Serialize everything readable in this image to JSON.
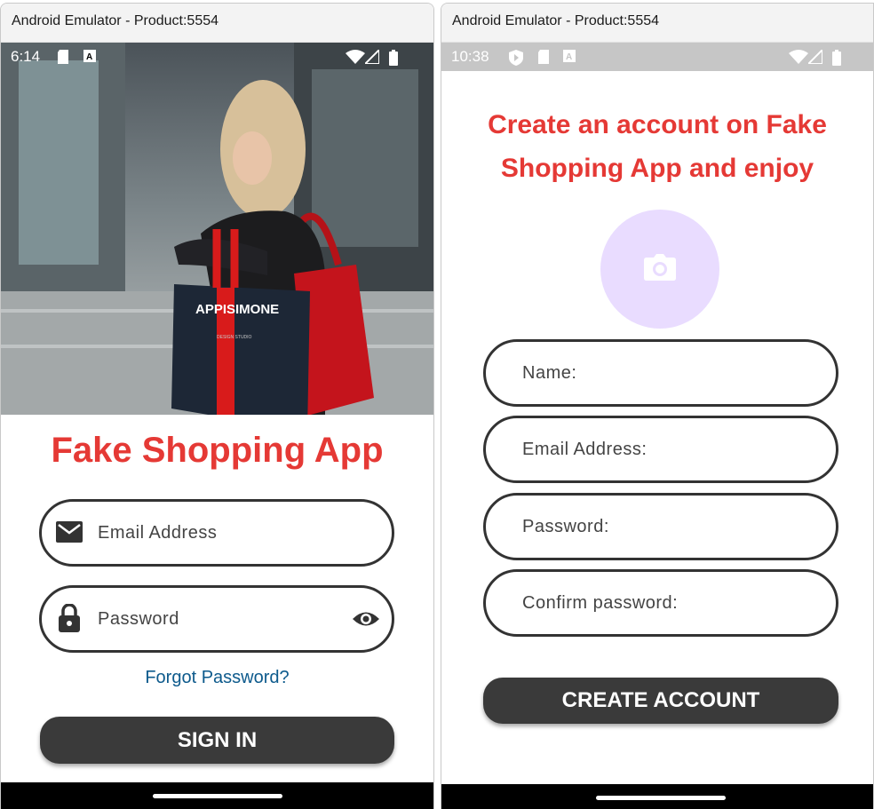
{
  "windows": {
    "left": {
      "title": "Android Emulator - Product:5554",
      "status_time": "6:14",
      "hero": {
        "bag_text": "APPISIMONE",
        "bag_subtext": "DESIGN STUDIO"
      },
      "app_title": "Fake Shopping App",
      "email_label": "Email Address",
      "password_label": "Password",
      "forgot_password": "Forgot Password?",
      "sign_in": "SIGN IN"
    },
    "right": {
      "title": "Android Emulator - Product:5554",
      "status_time": "10:38",
      "heading_line1": "Create an account on Fake",
      "heading_line2": "Shopping App and enjoy",
      "name_label": "Name:",
      "email_label": "Email Address:",
      "password_label": "Password:",
      "confirm_label": "Confirm password:",
      "create_account": "CREATE ACCOUNT"
    }
  },
  "colors": {
    "accent_red": "#e53935",
    "link_blue": "#0d5a8c",
    "button_dark": "#3a3a3a",
    "avatar_bg": "#e9dcff"
  },
  "icons": [
    "email-icon",
    "lock-icon",
    "eye-icon",
    "camera-icon",
    "wifi-icon",
    "signal-icon",
    "battery-icon",
    "sd-card-icon",
    "a-icon",
    "play-protect-icon"
  ]
}
